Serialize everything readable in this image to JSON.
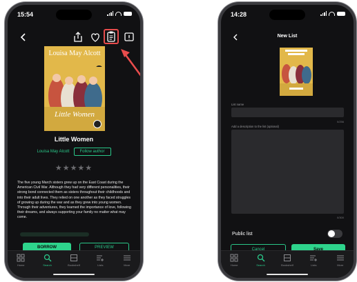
{
  "left_phone": {
    "status": {
      "time": "15:54"
    },
    "book": {
      "cover_author": "Louisa May Alcott",
      "cover_title": "Little Women",
      "title": "Little Women",
      "author": "Louisa May Alcott",
      "follow_label": "Follow author",
      "stars": "★★★★★",
      "description": "The five young March sisters grew up on the East Coast during the American Civil War. Although they had very different personalities, their strong bond connected them as sisters throughout their childhoods and into their adult lives. They relied on one another as they faced struggles of growing up during the war and as they grew into young women. Through their adventures, they learned the importance of love, following their dreams, and always supporting your family no matter what may come."
    },
    "buttons": {
      "borrow": "BORROW",
      "preview": "PREVIEW"
    },
    "tabs": [
      {
        "label": "Home",
        "icon": "home-icon"
      },
      {
        "label": "Search",
        "icon": "search-icon",
        "active": true
      },
      {
        "label": "Bookshelf",
        "icon": "bookshelf-icon"
      },
      {
        "label": "Lists",
        "icon": "lists-icon"
      },
      {
        "label": "More",
        "icon": "more-icon"
      }
    ]
  },
  "right_phone": {
    "status": {
      "time": "14:28"
    },
    "header": {
      "title": "New List"
    },
    "form": {
      "list_name_label": "List name",
      "list_name_counter": "0/256",
      "description_label": "Add a description to the list (optional)",
      "description_counter": "0/300",
      "public_label": "Public list"
    },
    "buttons": {
      "cancel": "Cancel",
      "save": "Save"
    },
    "tabs": [
      {
        "label": "Home",
        "icon": "home-icon"
      },
      {
        "label": "Search",
        "icon": "search-icon",
        "active": true
      },
      {
        "label": "Bookshelf",
        "icon": "bookshelf-icon"
      },
      {
        "label": "Lists",
        "icon": "lists-icon"
      },
      {
        "label": "More",
        "icon": "more-icon"
      }
    ]
  },
  "colors": {
    "accent": "#2ed48c",
    "highlight": "#e84c4c",
    "cover": "#e2b84a",
    "background": "#111113"
  }
}
